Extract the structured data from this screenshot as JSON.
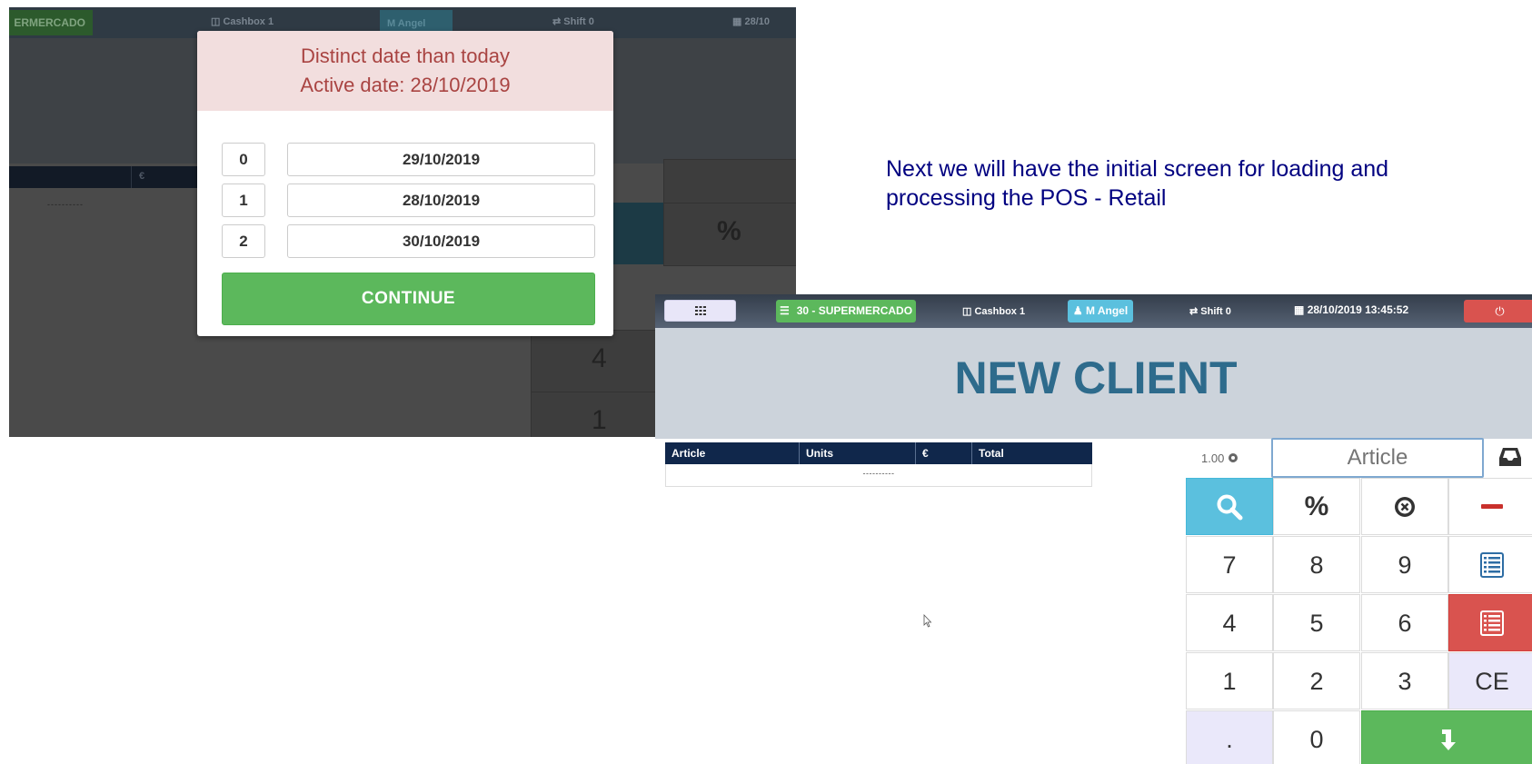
{
  "background_screen": {
    "topbar": {
      "store": "ERMERCADO",
      "cashbox": "Cashbox 1",
      "user": "M Angel",
      "shift": "Shift 0",
      "date": "28/10"
    },
    "table_currency": "€",
    "table_empty": "----------",
    "keypad_visible": [
      "%",
      "4",
      "1"
    ]
  },
  "date_modal": {
    "warning_line1": "Distinct date than today",
    "warning_line2": "Active date: 28/10/2019",
    "options": [
      {
        "index": "0",
        "date": "29/10/2019"
      },
      {
        "index": "1",
        "date": "28/10/2019"
      },
      {
        "index": "2",
        "date": "30/10/2019"
      }
    ],
    "continue_label": "CONTINUE"
  },
  "caption": "Next we will have the initial screen for loading and processing the POS - Retail",
  "pos": {
    "topbar": {
      "menu_icon": "grid-icon",
      "store_label": "30 - SUPERMERCADO",
      "cashbox_label": "Cashbox 1",
      "user_label": "M Angel",
      "shift_label": "Shift 0",
      "datetime": "28/10/2019 13:45:52",
      "power_icon": "power-icon"
    },
    "client_title": "NEW CLIENT",
    "table": {
      "columns": [
        "Article",
        "Units",
        "€",
        "Total"
      ],
      "empty_row": "----------"
    },
    "quantity": "1.00",
    "article_placeholder": "Article",
    "keypad": {
      "keys": [
        "7",
        "8",
        "9",
        "4",
        "5",
        "6",
        "1",
        "2",
        "3",
        "CE",
        ".",
        "0",
        "%"
      ]
    },
    "colors": {
      "accent_blue": "#5bc0de",
      "danger_red": "#d9534f",
      "success_green": "#5cb85c",
      "title_blue": "#2e6b8c",
      "table_header": "#10274b"
    }
  }
}
